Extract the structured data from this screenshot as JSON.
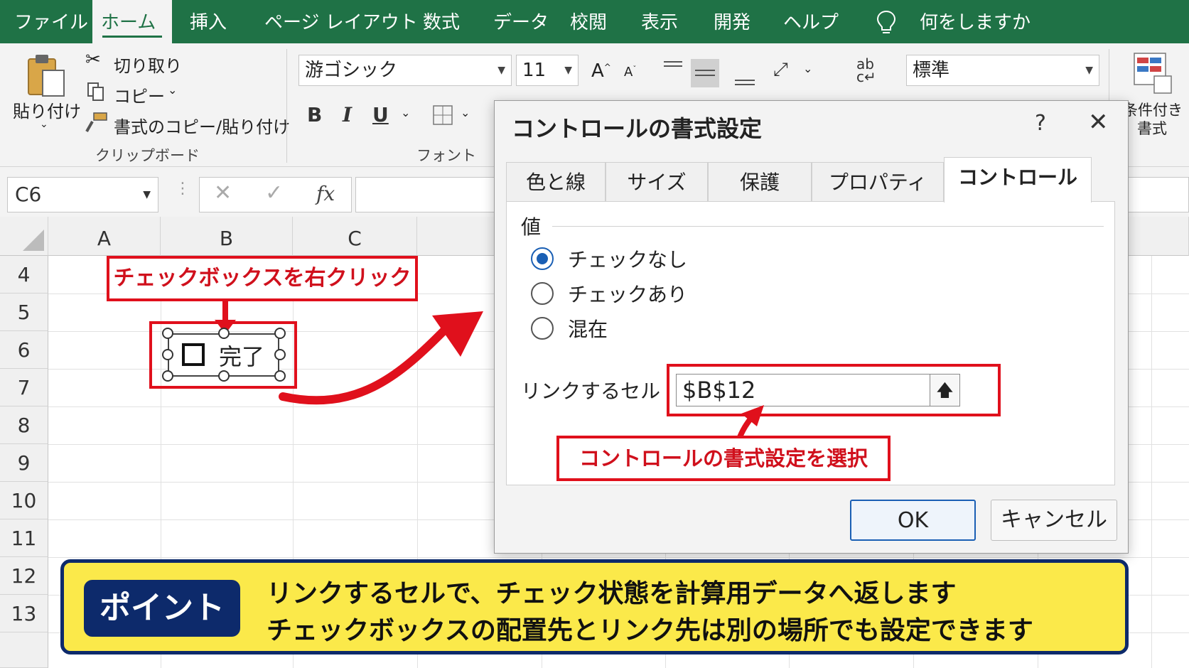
{
  "ribbon_tabs": [
    "ファイル",
    "ホーム",
    "挿入",
    "ページ レイアウト",
    "数式",
    "データ",
    "校閲",
    "表示",
    "開発",
    "ヘルプ"
  ],
  "tell_me": "何をしますか",
  "clipboard": {
    "paste": "貼り付け",
    "cut": "切り取り",
    "copy": "コピー",
    "format_painter": "書式のコピー/貼り付け",
    "group_label": "クリップボード"
  },
  "font": {
    "name": "游ゴシック",
    "size": "11",
    "group_label": "フォント",
    "bold": "B",
    "italic": "I",
    "underline": "U"
  },
  "number_format": "標準",
  "conditional_format": [
    "条件付き",
    "書式"
  ],
  "name_box": "C6",
  "fx": "fx",
  "columns": [
    "A",
    "B",
    "C"
  ],
  "rows": [
    "4",
    "5",
    "6",
    "7",
    "8",
    "9",
    "10",
    "11",
    "12",
    "13"
  ],
  "checkbox": {
    "label": "完了"
  },
  "callout_right_click": "チェックボックスを右クリック",
  "callout_select": "コントロールの書式設定を選択",
  "dialog": {
    "title": "コントロールの書式設定",
    "help": "?",
    "close": "✕",
    "tabs": [
      "色と線",
      "サイズ",
      "保護",
      "プロパティ",
      "コントロール"
    ],
    "active_tab": "コントロール",
    "value_section": "値",
    "options": [
      "チェックなし",
      "チェックあり",
      "混在"
    ],
    "selected_option": "チェックなし",
    "link_label": "リンクするセル",
    "link_value": "$B$12",
    "ok": "OK",
    "cancel": "キャンセル"
  },
  "point": {
    "badge": "ポイント",
    "line1": "リンクするセルで、チェック状態を計算用データへ返します",
    "line2": "チェックボックスの配置先とリンク先は別の場所でも設定できます"
  },
  "colors": {
    "excel_green": "#1f7246",
    "callout_red": "#e0101c",
    "point_yellow": "#fbe94a",
    "point_navy": "#0d2a6b",
    "radio_blue": "#1a5fb4"
  }
}
